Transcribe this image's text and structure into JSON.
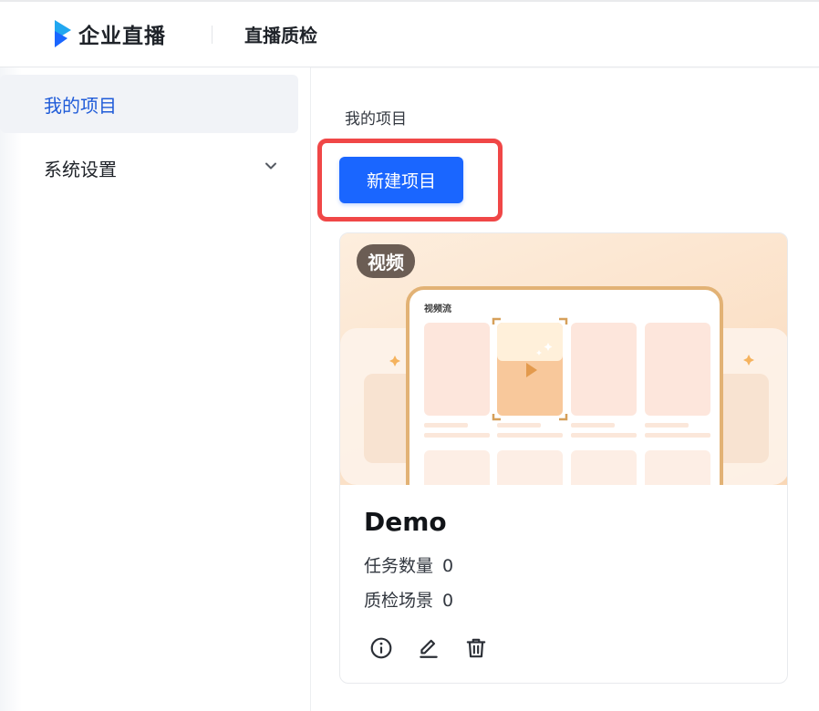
{
  "header": {
    "brand": "企业直播",
    "title": "直播质检"
  },
  "sidebar": {
    "items": [
      {
        "label": "我的项目",
        "active": true
      },
      {
        "label": "系统设置",
        "active": false,
        "icon": "chevron-down-icon"
      }
    ]
  },
  "main": {
    "breadcrumb": "我的项目",
    "new_button_label": "新建项目",
    "card": {
      "tag": "视频",
      "cover_caption": "视频流",
      "title": "Demo",
      "stats": [
        {
          "label": "任务数量",
          "value": "0"
        },
        {
          "label": "质检场景",
          "value": "0"
        }
      ],
      "actions": [
        "info-icon",
        "edit-icon",
        "delete-icon"
      ]
    }
  },
  "colors": {
    "accent": "#1a66ff",
    "active_nav_text": "#1f5bd8",
    "highlight": "#f04747",
    "tag_bg": "#6b5d54"
  }
}
